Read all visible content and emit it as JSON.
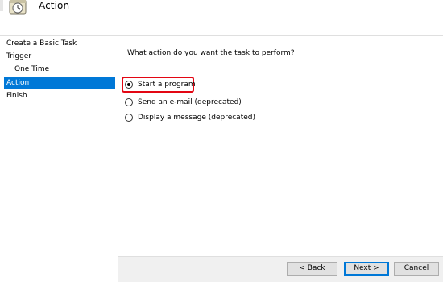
{
  "header": {
    "title": "Action",
    "icon": "clock-task-icon"
  },
  "steps": [
    {
      "label": "Create a Basic Task",
      "indent": false,
      "active": false
    },
    {
      "label": "Trigger",
      "indent": false,
      "active": false
    },
    {
      "label": "One Time",
      "indent": true,
      "active": false
    },
    {
      "label": "Action",
      "indent": false,
      "active": true
    },
    {
      "label": "Finish",
      "indent": false,
      "active": false
    }
  ],
  "content": {
    "question": "What action do you want the task to perform?",
    "options": [
      {
        "label": "Start a program",
        "selected": true
      },
      {
        "label": "Send an e-mail (deprecated)",
        "selected": false
      },
      {
        "label": "Display a message (deprecated)",
        "selected": false
      }
    ],
    "highlight_color": "#e30613"
  },
  "buttons": {
    "back": "< Back",
    "next": "Next >",
    "cancel": "Cancel"
  },
  "colors": {
    "accent": "#0078d7",
    "pane_bg": "#ffffff",
    "footer_bg": "#f0f0f0"
  }
}
